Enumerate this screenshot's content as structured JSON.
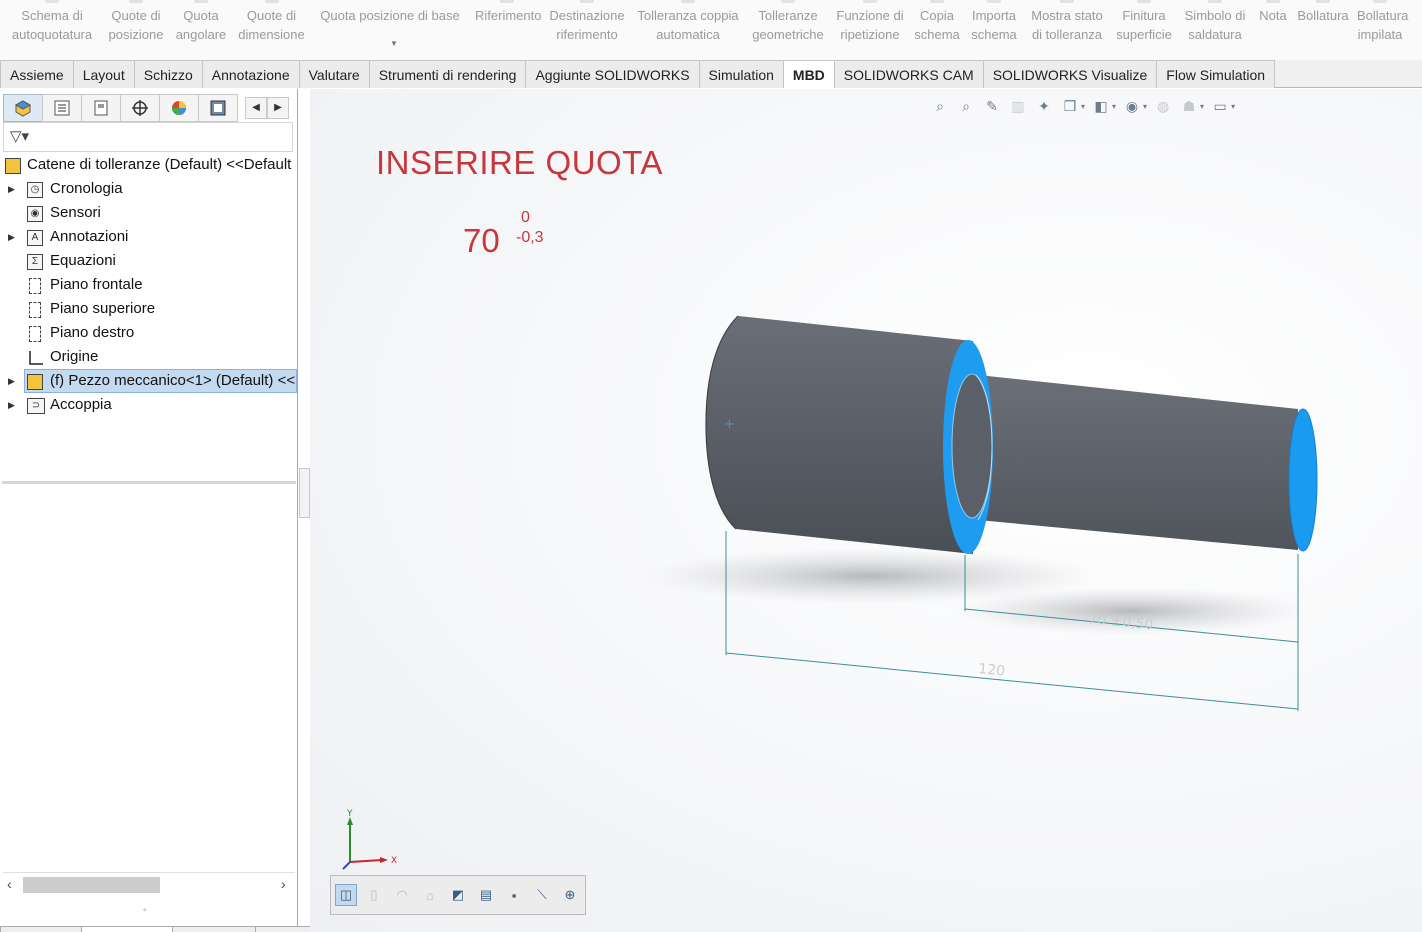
{
  "ribbon": {
    "buttons": [
      {
        "label": "Schema di\nautoquotatura"
      },
      {
        "label": "Quote di\nposizione"
      },
      {
        "label": "Quota\nangolare"
      },
      {
        "label": "Quote di\ndimensione"
      },
      {
        "label": "Quota posizione di base"
      },
      {
        "label": "Riferimento"
      },
      {
        "label": "Destinazione\nriferimento"
      },
      {
        "label": "Tolleranza coppia\nautomatica"
      },
      {
        "label": "Tolleranze\ngeometriche"
      },
      {
        "label": "Funzione di\nripetizione"
      },
      {
        "label": "Copia\nschema"
      },
      {
        "label": "Importa\nschema"
      },
      {
        "label": "Mostra stato\ndi tolleranza"
      },
      {
        "label": "Finitura\nsuperficie"
      },
      {
        "label": "Simbolo di\nsaldatura"
      },
      {
        "label": "Nota"
      },
      {
        "label": "Bollatura"
      },
      {
        "label": "Bollatura\nimpilata"
      }
    ]
  },
  "tabs": [
    "Assieme",
    "Layout",
    "Schizzo",
    "Annotazione",
    "Valutare",
    "Strumenti di rendering",
    "Aggiunte SOLIDWORKS",
    "Simulation",
    "MBD",
    "SOLIDWORKS CAM",
    "SOLIDWORKS Visualize",
    "Flow Simulation"
  ],
  "active_tab": "MBD",
  "tree": {
    "root": "Catene di tolleranze (Default) <<Default",
    "items": [
      {
        "label": "Cronologia",
        "icon": "folder-clock-icon",
        "expandable": true
      },
      {
        "label": "Sensori",
        "icon": "sensor-icon",
        "expandable": false
      },
      {
        "label": "Annotazioni",
        "icon": "annotation-icon",
        "expandable": true
      },
      {
        "label": "Equazioni",
        "icon": "equation-icon",
        "expandable": false
      },
      {
        "label": "Piano frontale",
        "icon": "plane-icon",
        "expandable": false
      },
      {
        "label": "Piano superiore",
        "icon": "plane-icon",
        "expandable": false
      },
      {
        "label": "Piano destro",
        "icon": "plane-icon",
        "expandable": false
      },
      {
        "label": "Origine",
        "icon": "origin-icon",
        "expandable": false
      },
      {
        "label": "(f) Pezzo meccanico<1> (Default) <<",
        "icon": "part-icon",
        "expandable": true,
        "selected": true
      },
      {
        "label": "Accoppia",
        "icon": "mate-icon",
        "expandable": true
      }
    ]
  },
  "viewport": {
    "title": "INSERIRE QUOTA",
    "dimension": {
      "nominal": "70",
      "upper": "0",
      "lower": "-0,3"
    },
    "model_dims": {
      "short": "70 ±0,50",
      "long": "120"
    },
    "axes": {
      "y": "Y",
      "x": "X"
    }
  },
  "colors": {
    "accent_red": "#c8373b",
    "part_face": "#5b5f67",
    "edge_blue": "#1e9cf0",
    "dim_teal": "#3b8e9a"
  }
}
